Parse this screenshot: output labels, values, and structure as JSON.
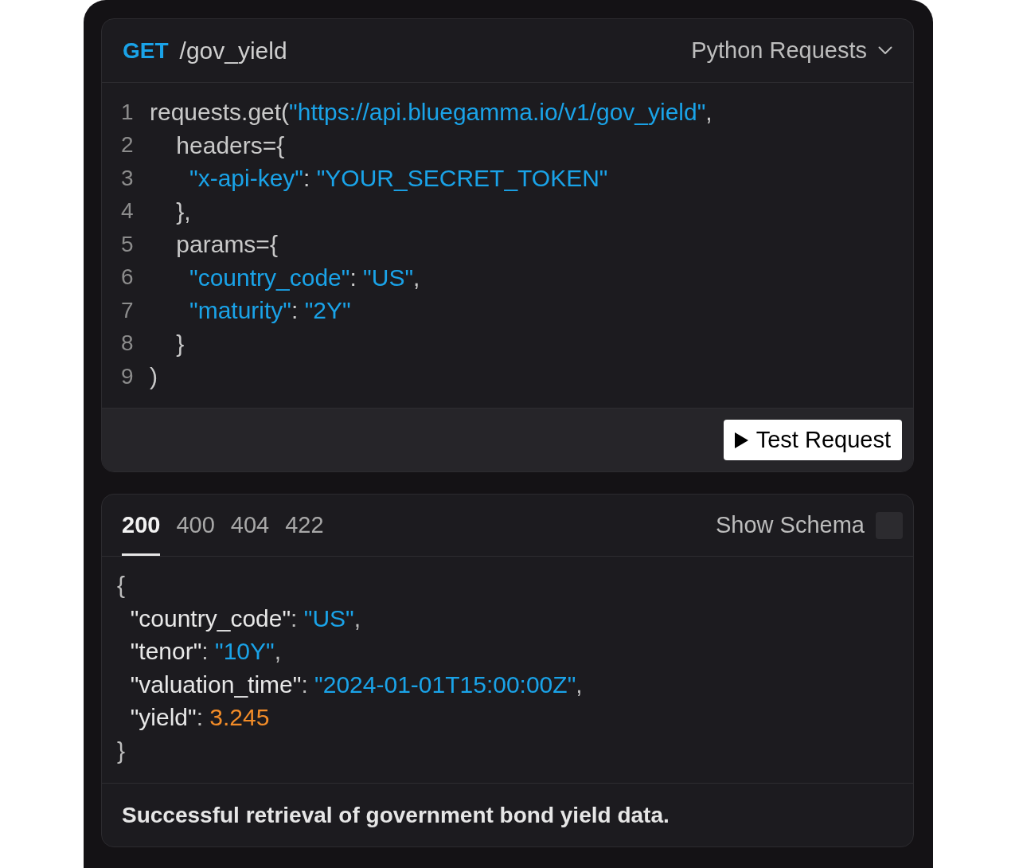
{
  "request": {
    "method": "GET",
    "path": "/gov_yield",
    "language": "Python Requests",
    "code_lines": [
      {
        "number": "1",
        "tokens": [
          {
            "kind": "plain",
            "text": "requests.get("
          },
          {
            "kind": "string",
            "text": "\"https://api.bluegamma.io/v1/gov_yield\""
          },
          {
            "kind": "plain",
            "text": ","
          }
        ]
      },
      {
        "number": "2",
        "tokens": [
          {
            "kind": "plain",
            "text": "    headers={"
          }
        ]
      },
      {
        "number": "3",
        "tokens": [
          {
            "kind": "string",
            "text": "      \"x-api-key\""
          },
          {
            "kind": "plain",
            "text": ": "
          },
          {
            "kind": "string",
            "text": "\"YOUR_SECRET_TOKEN\""
          }
        ]
      },
      {
        "number": "4",
        "tokens": [
          {
            "kind": "plain",
            "text": "    },"
          }
        ]
      },
      {
        "number": "5",
        "tokens": [
          {
            "kind": "plain",
            "text": "    params={"
          }
        ]
      },
      {
        "number": "6",
        "tokens": [
          {
            "kind": "string",
            "text": "      \"country_code\""
          },
          {
            "kind": "plain",
            "text": ": "
          },
          {
            "kind": "string",
            "text": "\"US\""
          },
          {
            "kind": "plain",
            "text": ","
          }
        ]
      },
      {
        "number": "7",
        "tokens": [
          {
            "kind": "string",
            "text": "      \"maturity\""
          },
          {
            "kind": "plain",
            "text": ": "
          },
          {
            "kind": "string",
            "text": "\"2Y\""
          }
        ]
      },
      {
        "number": "8",
        "tokens": [
          {
            "kind": "plain",
            "text": "    }"
          }
        ]
      },
      {
        "number": "9",
        "tokens": [
          {
            "kind": "plain",
            "text": ")"
          }
        ]
      }
    ],
    "test_button": "Test Request"
  },
  "response": {
    "tabs": [
      {
        "label": "200",
        "selected": true
      },
      {
        "label": "400",
        "selected": false
      },
      {
        "label": "404",
        "selected": false
      },
      {
        "label": "422",
        "selected": false
      }
    ],
    "show_schema": {
      "label": "Show Schema",
      "checked": false
    },
    "body_lines": [
      {
        "tokens": [
          {
            "kind": "punct",
            "text": "{"
          }
        ]
      },
      {
        "tokens": [
          {
            "kind": "key",
            "text": "  \"country_code\""
          },
          {
            "kind": "punct",
            "text": ": "
          },
          {
            "kind": "string",
            "text": "\"US\""
          },
          {
            "kind": "punct",
            "text": ","
          }
        ]
      },
      {
        "tokens": [
          {
            "kind": "key",
            "text": "  \"tenor\""
          },
          {
            "kind": "punct",
            "text": ": "
          },
          {
            "kind": "string",
            "text": "\"10Y\""
          },
          {
            "kind": "punct",
            "text": ","
          }
        ]
      },
      {
        "tokens": [
          {
            "kind": "key",
            "text": "  \"valuation_time\""
          },
          {
            "kind": "punct",
            "text": ": "
          },
          {
            "kind": "string",
            "text": "\"2024-01-01T15:00:00Z\""
          },
          {
            "kind": "punct",
            "text": ","
          }
        ]
      },
      {
        "tokens": [
          {
            "kind": "key",
            "text": "  \"yield\""
          },
          {
            "kind": "punct",
            "text": ": "
          },
          {
            "kind": "number",
            "text": "3.245"
          }
        ]
      },
      {
        "tokens": [
          {
            "kind": "punct",
            "text": "}"
          }
        ]
      }
    ],
    "description": "Successful retrieval of government bond yield data."
  }
}
